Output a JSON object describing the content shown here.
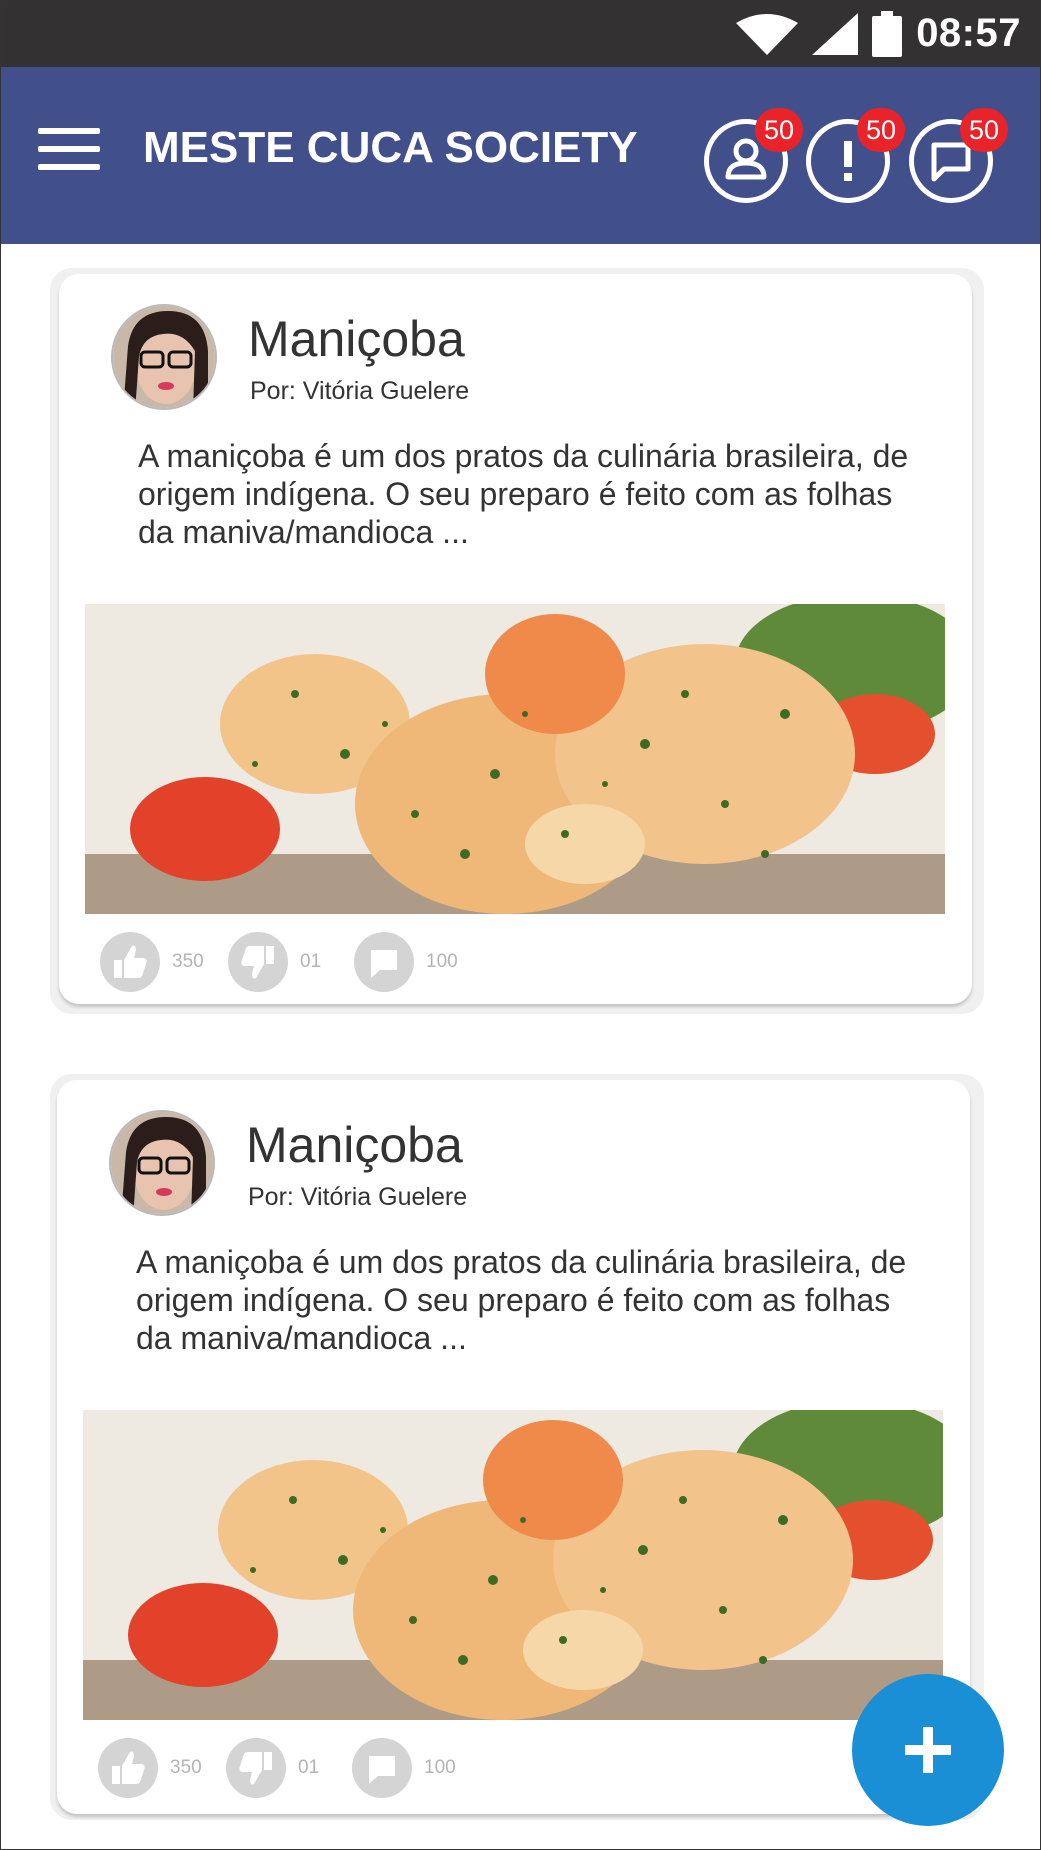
{
  "status_bar": {
    "time": "08:57"
  },
  "app_bar": {
    "title": "MESTE CUCA SOCIETY",
    "actions": [
      {
        "icon": "user-icon",
        "badge": "50"
      },
      {
        "icon": "alert-icon",
        "badge": "50"
      },
      {
        "icon": "chat-icon",
        "badge": "50"
      }
    ]
  },
  "posts": [
    {
      "title": "Maniçoba",
      "author": "Por: Vitória Guelere",
      "text": "A maniçoba é um dos pratos da culinária brasileira, de origem indígena. O seu preparo é feito com as folhas da maniva/mandioca ...",
      "likes": "350",
      "dislikes": "01",
      "comments": "100"
    },
    {
      "title": "Maniçoba",
      "author": "Por: Vitória Guelere",
      "text": "A maniçoba é um dos pratos da culinária brasileira, de origem indígena. O seu preparo é feito com as folhas da maniva/mandioca ...",
      "likes": "350",
      "dislikes": "01",
      "comments": "100"
    }
  ],
  "colors": {
    "status_bar": "#333132",
    "app_bar": "#414f8a",
    "badge": "#e8232a",
    "fab": "#1a8fd6",
    "action_icon_bg": "#d4d4d4"
  },
  "fab": {
    "icon": "plus-icon"
  }
}
